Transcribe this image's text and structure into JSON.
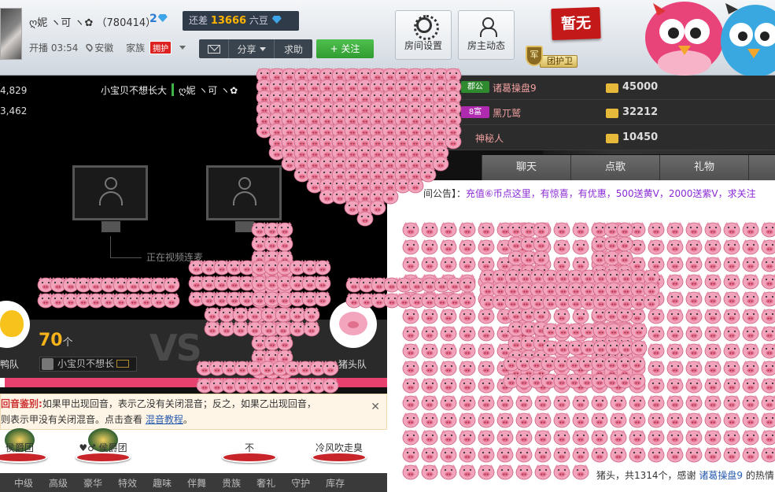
{
  "header": {
    "host_name": "ღ妮 ヽ可 ヽ✿",
    "host_id": "（780414）",
    "level": "2",
    "gap_label": "还差",
    "gap_value": "13666",
    "gap_unit": "六豆",
    "live_time": "开播 03:54",
    "location": "安徽",
    "family_label": "家族",
    "guard_badge": "拥护",
    "share_label": "分享",
    "help_label": "求助",
    "follow_label": "+ 关注",
    "room_settings_label": "房间设置",
    "host_feed_label": "房主动态",
    "badge_none": "暂无",
    "guard_shield": "军",
    "guard_group_label": "团护卫"
  },
  "video": {
    "stat1": "4,829",
    "stat2": "3,462",
    "pk_left_name": "小宝贝不想长大",
    "pk_right_name": "ღ妮 ヽ可 ヽ✿",
    "connecting_text": "正在视频连麦",
    "score": "70",
    "score_unit": "个",
    "vs": "VS",
    "top_fan": "小宝贝不想长",
    "team_a": "鸭队",
    "team_b": "猪头队"
  },
  "notice": {
    "title": "回音鉴别:",
    "line1": "如果甲出现回音，表示乙没有关闭混音；反之，如果乙出现回音，",
    "line2": "则表示甲没有关闭混音。点击查看",
    "link": "混音教程",
    "close": "✕"
  },
  "fans": [
    {
      "label": "侯爵团"
    },
    {
      "label": "♥♂ 侯爵团"
    },
    {
      "label": "不"
    },
    {
      "label": "冷风吹走臭"
    }
  ],
  "bottom_tabs": [
    "中级",
    "高级",
    "豪华",
    "特效",
    "趣味",
    "伴舞",
    "贵族",
    "奢礼",
    "守护",
    "库存"
  ],
  "ranking": [
    {
      "badge": "郡公",
      "badge_color": "#2f8a2f",
      "name": "诸葛操盘9",
      "value": "45000"
    },
    {
      "badge": "8富",
      "badge_color": "#b02ab0",
      "name": "黑兀鹫",
      "value": "32212"
    },
    {
      "badge": "",
      "badge_color": "#2c2c2c",
      "name": "神秘人",
      "value": "10450"
    }
  ],
  "tabs_right": [
    "聊天",
    "点歌",
    "礼物"
  ],
  "chat": {
    "announce_prefix": "间公告】：",
    "announce_text": "充值⑥币点这里，有惊喜，有优惠，500送黄V，2000送紫V，求关注",
    "footer_prefix": "猪头，共1314个，感谢",
    "footer_name": "诸葛操盘9",
    "footer_suffix": "的热情"
  },
  "colors": {
    "pig_pink": "#f2a4bd",
    "follow_green": "#3fae3f",
    "pk_pink": "#e6416f",
    "badge_red": "#c41919"
  }
}
